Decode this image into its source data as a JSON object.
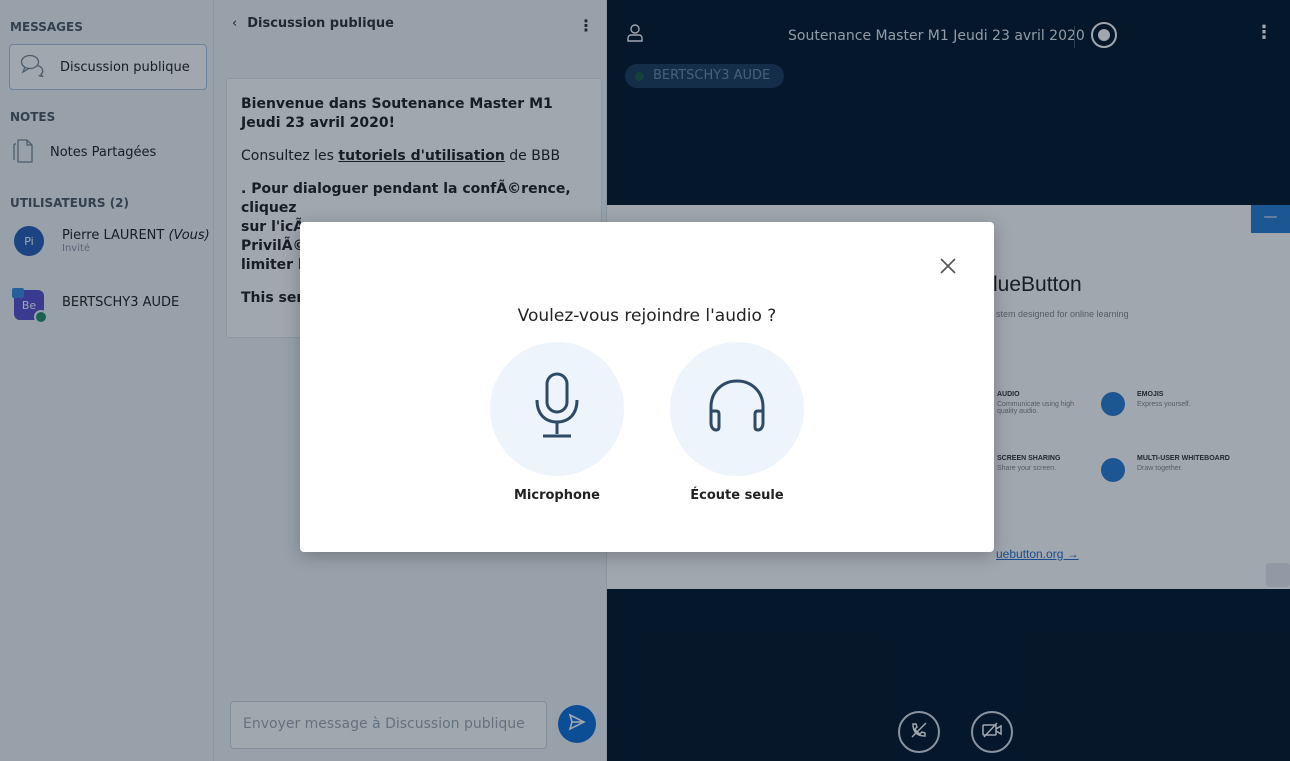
{
  "sidebar": {
    "messages_title": "MESSAGES",
    "public_chat_label": "Discussion publique",
    "notes_title": "NOTES",
    "shared_notes_label": "Notes Partagées",
    "users_title": "UTILISATEURS (2)",
    "users": [
      {
        "initials": "Pi",
        "name": "Pierre LAURENT",
        "you_tag": "(Vous)",
        "role": "Invité",
        "color": "#2a5fb8"
      },
      {
        "initials": "Be",
        "name": "BERTSCHY3 AUDE",
        "you_tag": "",
        "role": "",
        "color": "#5a4fcf"
      }
    ]
  },
  "chat": {
    "title": "Discussion publique",
    "welcome_prefix": "Bienvenue dans ",
    "welcome_name": "Soutenance Master M1 Jeudi 23 avril 2020",
    "welcome_suffix": "!",
    "consult_prefix": "Consultez les ",
    "consult_link": "tutoriels d'utilisation",
    "consult_suffix": " de BBB",
    "line3": ". Pour dialoguer pendant la confÃ©rence, cliquez",
    "line4": "sur l'icÃ",
    "line5": "PrivilÃ©",
    "line6": "limiter l",
    "line7": "This serv",
    "input_placeholder": "Envoyer message à Discussion publique"
  },
  "main": {
    "meeting_title": "Soutenance Master M1 Jeudi 23 avril 2020",
    "talker": "BERTSCHY3 AUDE",
    "slide": {
      "heading": "lueButton",
      "subheading": "stem designed for online learning",
      "features": [
        {
          "title": "AUDIO",
          "desc": "Communicate using high quality audio."
        },
        {
          "title": "EMOJIS",
          "desc": "Express yourself."
        },
        {
          "title": "SCREEN SHARING",
          "desc": "Share your screen."
        },
        {
          "title": "MULTI-USER WHITEBOARD",
          "desc": "Draw together."
        }
      ],
      "link": "uebutton.org →"
    }
  },
  "modal": {
    "title": "Voulez-vous rejoindre l'audio ?",
    "microphone_label": "Microphone",
    "listen_only_label": "Écoute seule"
  },
  "colors": {
    "accent": "#0f70d7",
    "main_bg": "#06172a",
    "icon_blue": "#2e4a66"
  }
}
